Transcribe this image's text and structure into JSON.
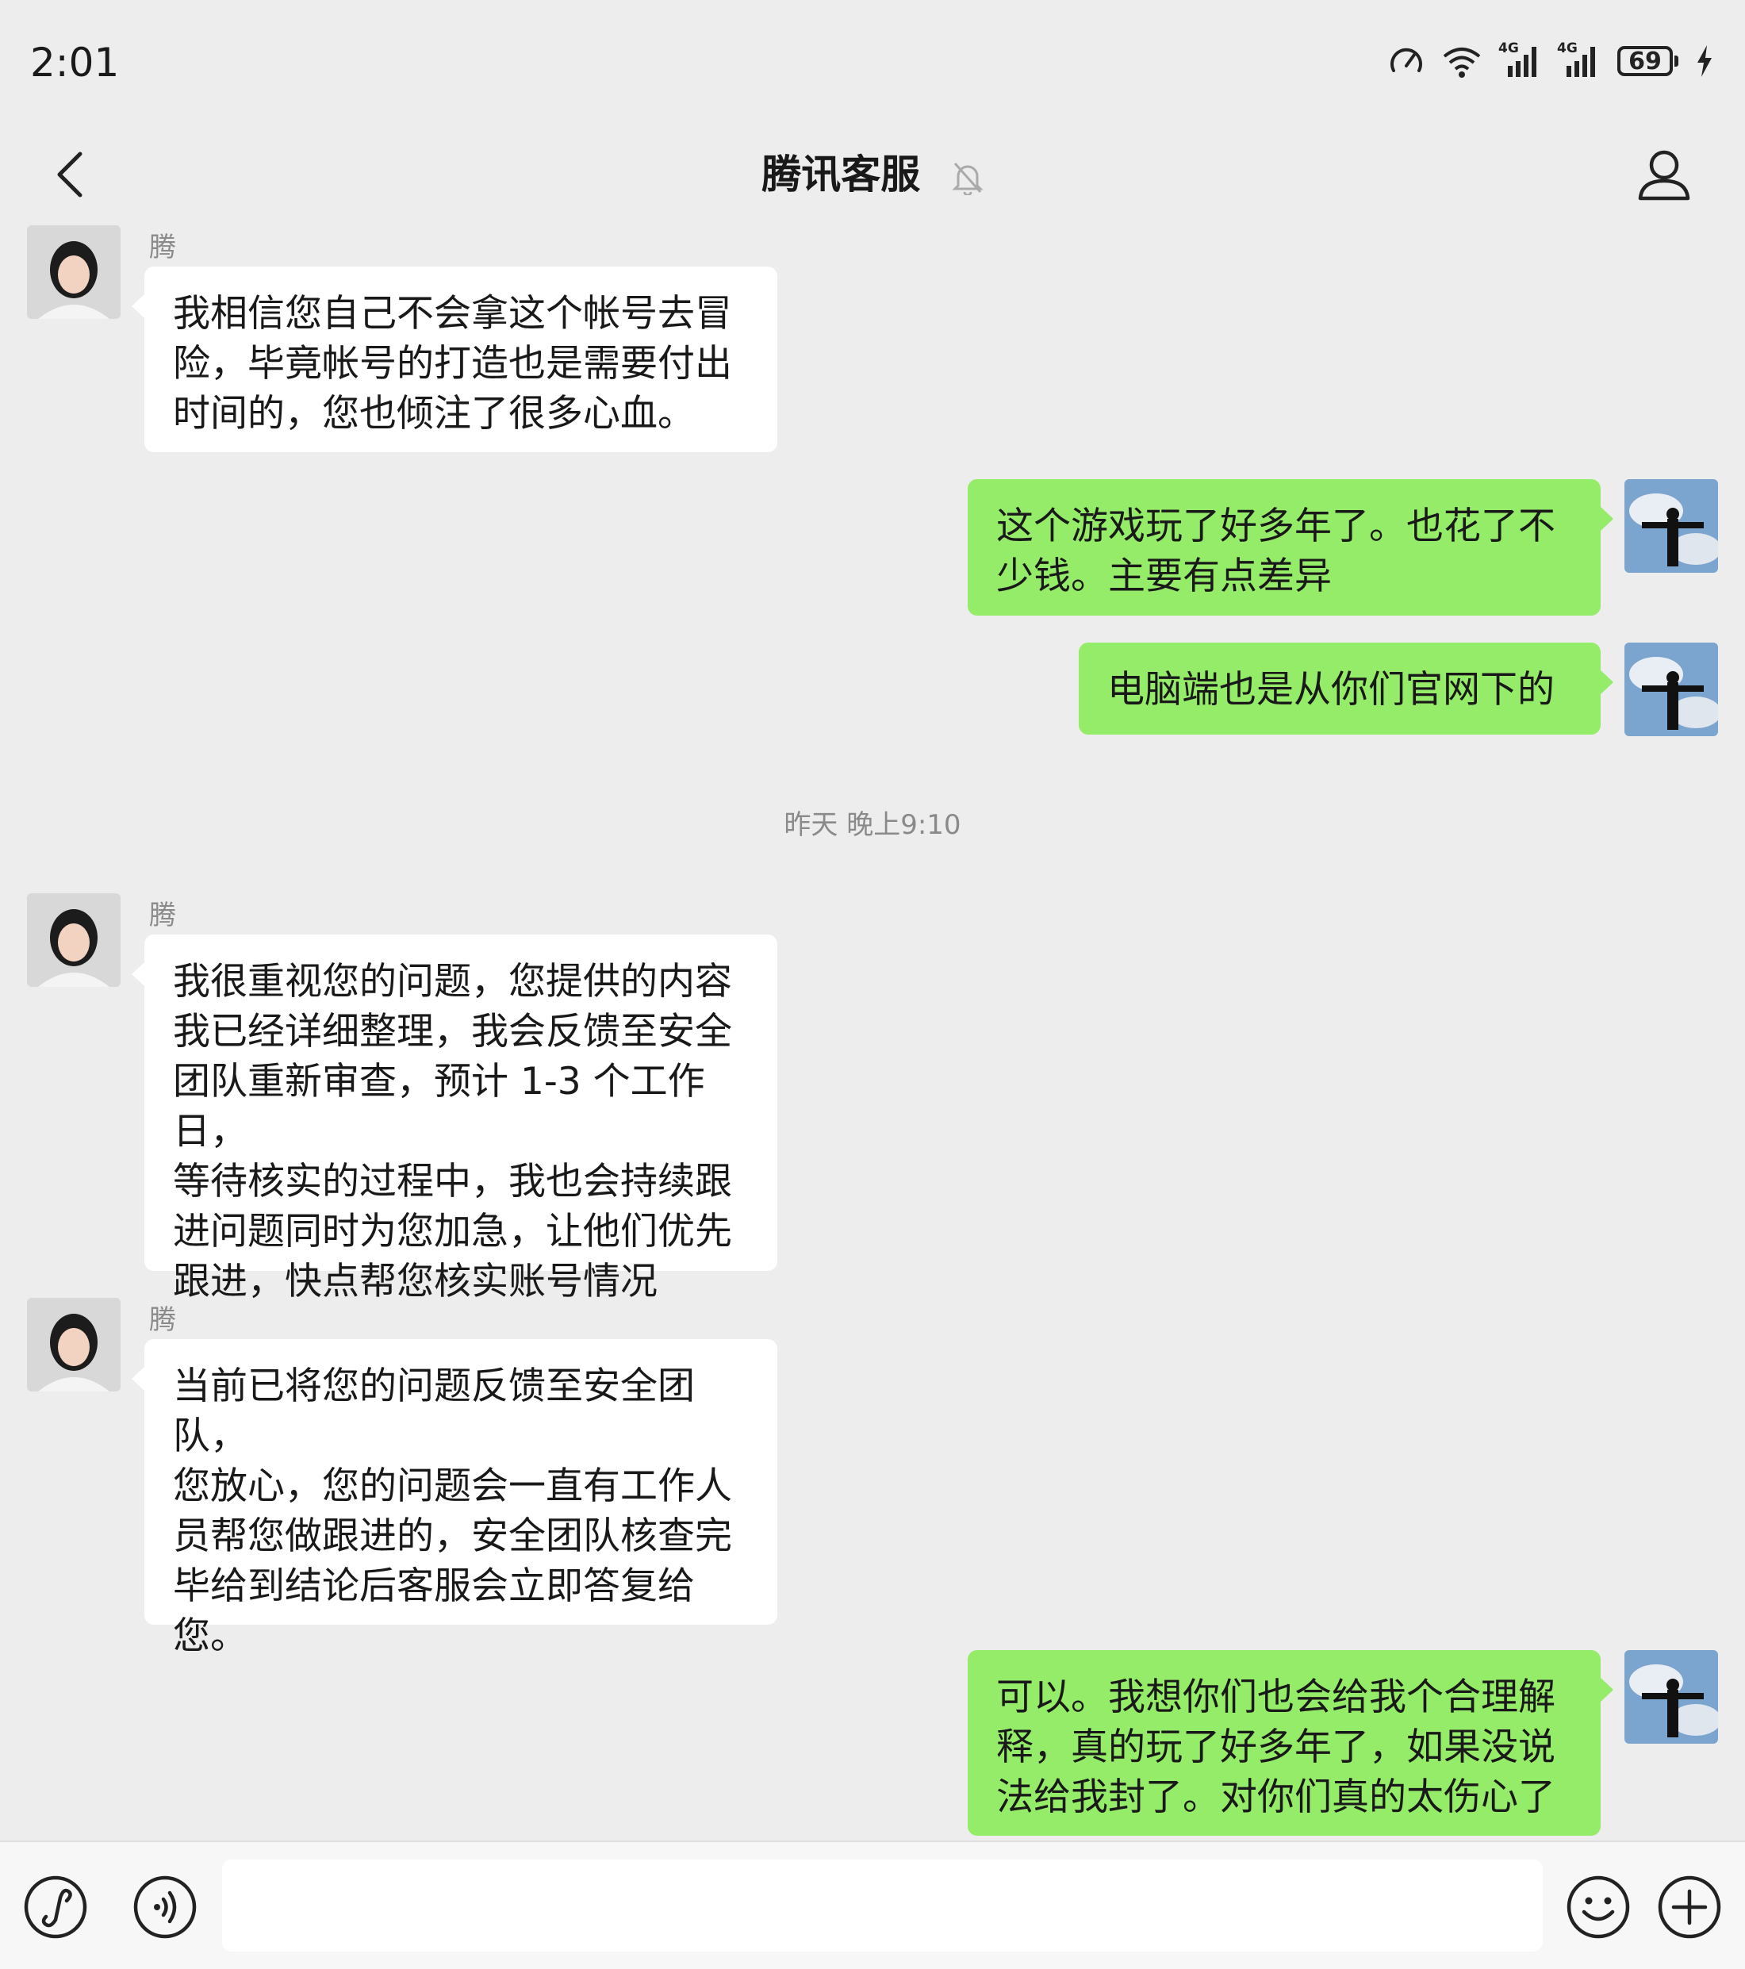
{
  "status_bar": {
    "time": "2:01",
    "battery": "69",
    "network_1": "4G",
    "network_2": "4G"
  },
  "header": {
    "title": "腾讯客服"
  },
  "messages": [
    {
      "side": "in",
      "sender": "腾讯客服",
      "text": "我相信您自己不会拿这个帐号去冒\n险，毕竟帐号的打造也是需要付出\n时间的，您也倾注了很多心血。"
    },
    {
      "side": "out",
      "text": "这个游戏玩了好多年了。也花了不\n少钱。主要有点差异"
    },
    {
      "side": "out",
      "text": "电脑端也是从你们官网下的"
    },
    {
      "side": "in",
      "sender": "腾讯客服",
      "text": "我很重视您的问题，您提供的内容\n我已经详细整理，我会反馈至安全\n团队重新审查，预计 1-3 个工作日，\n等待核实的过程中，我也会持续跟\n进问题同时为您加急，让他们优先\n跟进，快点帮您核实账号情况"
    },
    {
      "side": "in",
      "sender": "腾讯客服",
      "text": "当前已将您的问题反馈至安全团队，\n您放心，您的问题会一直有工作人\n员帮您做跟进的，安全团队核查完\n毕给到结论后客服会立即答复给\n您。"
    },
    {
      "side": "out",
      "text": "可以。我想你们也会给我个合理解\n释，真的玩了好多年了，如果没说\n法给我封了。对你们真的太伤心了"
    }
  ],
  "timestamp": "昨天 晚上9:10",
  "input": {
    "value": ""
  },
  "icons": {
    "back": "back-chevron-icon",
    "mute": "muted-bell-icon",
    "profile": "person-icon",
    "mini_program": "link-icon",
    "voice": "voice-icon",
    "emoji": "emoji-icon",
    "plus": "plus-icon"
  },
  "colors": {
    "background": "#ededed",
    "outgoing_bubble": "#95ec69",
    "incoming_bubble": "#ffffff",
    "input_bar": "#f7f7f7"
  }
}
